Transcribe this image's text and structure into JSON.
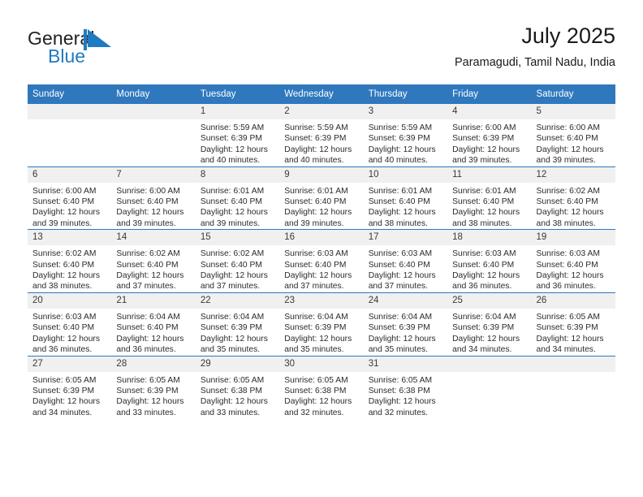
{
  "brand": {
    "name_part1": "General",
    "name_part2": "Blue",
    "mark": "triangle-flag-icon",
    "accent_color": "#1f7bc1"
  },
  "header": {
    "title": "July 2025",
    "subtitle": "Paramagudi, Tamil Nadu, India"
  },
  "colors": {
    "header_blue": "#2f78bd",
    "daynum_band": "#f0f0f0",
    "text": "#2b2b2b"
  },
  "weekday_headers": [
    "Sunday",
    "Monday",
    "Tuesday",
    "Wednesday",
    "Thursday",
    "Friday",
    "Saturday"
  ],
  "weeks": [
    [
      {
        "day": "",
        "sunrise": "",
        "sunset": "",
        "daylight_line1": "",
        "daylight_line2": "",
        "empty": true
      },
      {
        "day": "",
        "sunrise": "",
        "sunset": "",
        "daylight_line1": "",
        "daylight_line2": "",
        "empty": true
      },
      {
        "day": "1",
        "sunrise": "Sunrise: 5:59 AM",
        "sunset": "Sunset: 6:39 PM",
        "daylight_line1": "Daylight: 12 hours",
        "daylight_line2": "and 40 minutes."
      },
      {
        "day": "2",
        "sunrise": "Sunrise: 5:59 AM",
        "sunset": "Sunset: 6:39 PM",
        "daylight_line1": "Daylight: 12 hours",
        "daylight_line2": "and 40 minutes."
      },
      {
        "day": "3",
        "sunrise": "Sunrise: 5:59 AM",
        "sunset": "Sunset: 6:39 PM",
        "daylight_line1": "Daylight: 12 hours",
        "daylight_line2": "and 40 minutes."
      },
      {
        "day": "4",
        "sunrise": "Sunrise: 6:00 AM",
        "sunset": "Sunset: 6:39 PM",
        "daylight_line1": "Daylight: 12 hours",
        "daylight_line2": "and 39 minutes."
      },
      {
        "day": "5",
        "sunrise": "Sunrise: 6:00 AM",
        "sunset": "Sunset: 6:40 PM",
        "daylight_line1": "Daylight: 12 hours",
        "daylight_line2": "and 39 minutes."
      }
    ],
    [
      {
        "day": "6",
        "sunrise": "Sunrise: 6:00 AM",
        "sunset": "Sunset: 6:40 PM",
        "daylight_line1": "Daylight: 12 hours",
        "daylight_line2": "and 39 minutes."
      },
      {
        "day": "7",
        "sunrise": "Sunrise: 6:00 AM",
        "sunset": "Sunset: 6:40 PM",
        "daylight_line1": "Daylight: 12 hours",
        "daylight_line2": "and 39 minutes."
      },
      {
        "day": "8",
        "sunrise": "Sunrise: 6:01 AM",
        "sunset": "Sunset: 6:40 PM",
        "daylight_line1": "Daylight: 12 hours",
        "daylight_line2": "and 39 minutes."
      },
      {
        "day": "9",
        "sunrise": "Sunrise: 6:01 AM",
        "sunset": "Sunset: 6:40 PM",
        "daylight_line1": "Daylight: 12 hours",
        "daylight_line2": "and 39 minutes."
      },
      {
        "day": "10",
        "sunrise": "Sunrise: 6:01 AM",
        "sunset": "Sunset: 6:40 PM",
        "daylight_line1": "Daylight: 12 hours",
        "daylight_line2": "and 38 minutes."
      },
      {
        "day": "11",
        "sunrise": "Sunrise: 6:01 AM",
        "sunset": "Sunset: 6:40 PM",
        "daylight_line1": "Daylight: 12 hours",
        "daylight_line2": "and 38 minutes."
      },
      {
        "day": "12",
        "sunrise": "Sunrise: 6:02 AM",
        "sunset": "Sunset: 6:40 PM",
        "daylight_line1": "Daylight: 12 hours",
        "daylight_line2": "and 38 minutes."
      }
    ],
    [
      {
        "day": "13",
        "sunrise": "Sunrise: 6:02 AM",
        "sunset": "Sunset: 6:40 PM",
        "daylight_line1": "Daylight: 12 hours",
        "daylight_line2": "and 38 minutes."
      },
      {
        "day": "14",
        "sunrise": "Sunrise: 6:02 AM",
        "sunset": "Sunset: 6:40 PM",
        "daylight_line1": "Daylight: 12 hours",
        "daylight_line2": "and 37 minutes."
      },
      {
        "day": "15",
        "sunrise": "Sunrise: 6:02 AM",
        "sunset": "Sunset: 6:40 PM",
        "daylight_line1": "Daylight: 12 hours",
        "daylight_line2": "and 37 minutes."
      },
      {
        "day": "16",
        "sunrise": "Sunrise: 6:03 AM",
        "sunset": "Sunset: 6:40 PM",
        "daylight_line1": "Daylight: 12 hours",
        "daylight_line2": "and 37 minutes."
      },
      {
        "day": "17",
        "sunrise": "Sunrise: 6:03 AM",
        "sunset": "Sunset: 6:40 PM",
        "daylight_line1": "Daylight: 12 hours",
        "daylight_line2": "and 37 minutes."
      },
      {
        "day": "18",
        "sunrise": "Sunrise: 6:03 AM",
        "sunset": "Sunset: 6:40 PM",
        "daylight_line1": "Daylight: 12 hours",
        "daylight_line2": "and 36 minutes."
      },
      {
        "day": "19",
        "sunrise": "Sunrise: 6:03 AM",
        "sunset": "Sunset: 6:40 PM",
        "daylight_line1": "Daylight: 12 hours",
        "daylight_line2": "and 36 minutes."
      }
    ],
    [
      {
        "day": "20",
        "sunrise": "Sunrise: 6:03 AM",
        "sunset": "Sunset: 6:40 PM",
        "daylight_line1": "Daylight: 12 hours",
        "daylight_line2": "and 36 minutes."
      },
      {
        "day": "21",
        "sunrise": "Sunrise: 6:04 AM",
        "sunset": "Sunset: 6:40 PM",
        "daylight_line1": "Daylight: 12 hours",
        "daylight_line2": "and 36 minutes."
      },
      {
        "day": "22",
        "sunrise": "Sunrise: 6:04 AM",
        "sunset": "Sunset: 6:39 PM",
        "daylight_line1": "Daylight: 12 hours",
        "daylight_line2": "and 35 minutes."
      },
      {
        "day": "23",
        "sunrise": "Sunrise: 6:04 AM",
        "sunset": "Sunset: 6:39 PM",
        "daylight_line1": "Daylight: 12 hours",
        "daylight_line2": "and 35 minutes."
      },
      {
        "day": "24",
        "sunrise": "Sunrise: 6:04 AM",
        "sunset": "Sunset: 6:39 PM",
        "daylight_line1": "Daylight: 12 hours",
        "daylight_line2": "and 35 minutes."
      },
      {
        "day": "25",
        "sunrise": "Sunrise: 6:04 AM",
        "sunset": "Sunset: 6:39 PM",
        "daylight_line1": "Daylight: 12 hours",
        "daylight_line2": "and 34 minutes."
      },
      {
        "day": "26",
        "sunrise": "Sunrise: 6:05 AM",
        "sunset": "Sunset: 6:39 PM",
        "daylight_line1": "Daylight: 12 hours",
        "daylight_line2": "and 34 minutes."
      }
    ],
    [
      {
        "day": "27",
        "sunrise": "Sunrise: 6:05 AM",
        "sunset": "Sunset: 6:39 PM",
        "daylight_line1": "Daylight: 12 hours",
        "daylight_line2": "and 34 minutes."
      },
      {
        "day": "28",
        "sunrise": "Sunrise: 6:05 AM",
        "sunset": "Sunset: 6:39 PM",
        "daylight_line1": "Daylight: 12 hours",
        "daylight_line2": "and 33 minutes."
      },
      {
        "day": "29",
        "sunrise": "Sunrise: 6:05 AM",
        "sunset": "Sunset: 6:38 PM",
        "daylight_line1": "Daylight: 12 hours",
        "daylight_line2": "and 33 minutes."
      },
      {
        "day": "30",
        "sunrise": "Sunrise: 6:05 AM",
        "sunset": "Sunset: 6:38 PM",
        "daylight_line1": "Daylight: 12 hours",
        "daylight_line2": "and 32 minutes."
      },
      {
        "day": "31",
        "sunrise": "Sunrise: 6:05 AM",
        "sunset": "Sunset: 6:38 PM",
        "daylight_line1": "Daylight: 12 hours",
        "daylight_line2": "and 32 minutes."
      },
      {
        "day": "",
        "sunrise": "",
        "sunset": "",
        "daylight_line1": "",
        "daylight_line2": "",
        "empty": true
      },
      {
        "day": "",
        "sunrise": "",
        "sunset": "",
        "daylight_line1": "",
        "daylight_line2": "",
        "empty": true
      }
    ]
  ]
}
